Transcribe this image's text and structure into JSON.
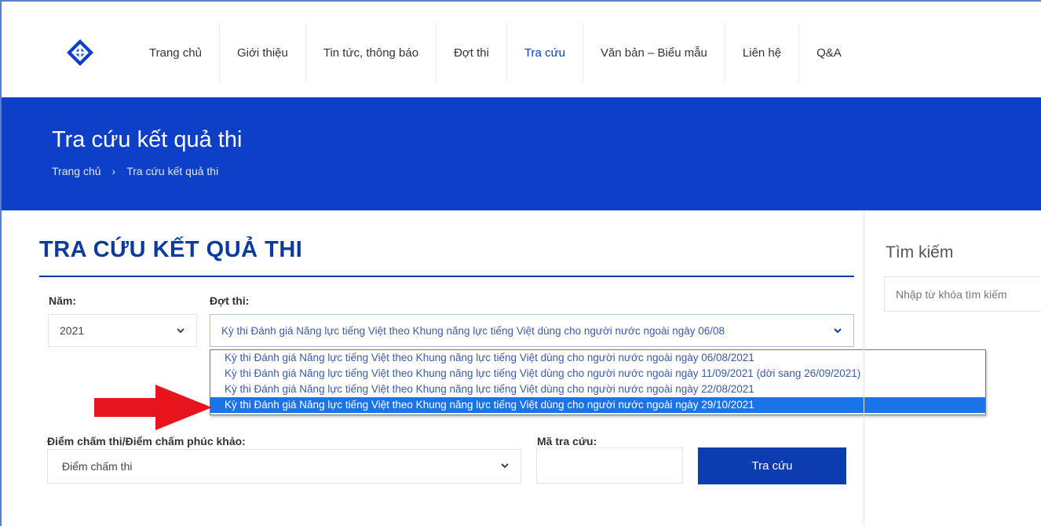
{
  "nav": {
    "items": [
      {
        "label": "Trang chủ",
        "active": false
      },
      {
        "label": "Giới thiệu",
        "active": false
      },
      {
        "label": "Tin tức, thông báo",
        "active": false
      },
      {
        "label": "Đợt thi",
        "active": false
      },
      {
        "label": "Tra cứu",
        "active": true
      },
      {
        "label": "Văn bản – Biểu mẫu",
        "active": false
      },
      {
        "label": "Liên hệ",
        "active": false
      },
      {
        "label": "Q&A",
        "active": false
      }
    ]
  },
  "banner": {
    "title": "Tra cứu kết quả thi",
    "breadcrumb": [
      "Trang chủ",
      "›",
      "Tra cứu kết quả thi"
    ]
  },
  "main": {
    "title": "TRA CỨU KẾT QUẢ THI",
    "year_label": "Năm:",
    "year_value": "2021",
    "exam_label": "Đợt thi:",
    "exam_value": "Kỳ thi Đánh giá Năng lực tiếng Việt theo Khung năng lực tiếng Việt dùng cho người nước ngoài ngày 06/08",
    "exam_options": [
      "Kỳ thi Đánh giá Năng lực tiếng Việt theo Khung năng lực tiếng Việt dùng cho người nước ngoài ngày 06/08/2021",
      "Kỳ thi Đánh giá Năng lực tiếng Việt theo Khung năng lực tiếng Việt dùng cho người nước ngoài ngày 11/09/2021 (dời sang 26/09/2021)",
      "Kỳ thi Đánh giá Năng lực tiếng Việt theo Khung năng lực tiếng Việt dùng cho người nước ngoài ngày 22/08/2021",
      "Kỳ thi Đánh giá Năng lực tiếng Việt theo Khung năng lực tiếng Việt dùng cho người nước ngoài ngày 29/10/2021"
    ],
    "exam_selected_index": 3,
    "score_label": "Điểm chấm thi/Điểm chấm phúc khảo:",
    "score_value": "Điểm chấm thi",
    "code_label": "Mã tra cứu:",
    "code_value": "",
    "submit_label": "Tra cứu"
  },
  "sidebar": {
    "title": "Tìm kiếm",
    "search_placeholder": "Nhập từ khóa tìm kiếm"
  },
  "colors": {
    "brand_blue": "#0d40c7",
    "title_blue": "#0d3a9e",
    "selected_option": "#1a73e8",
    "annotation_arrow": "#e8141c"
  },
  "icons": {
    "logo": "logo-icon",
    "dropdown": "chevron-down-icon",
    "annotation": "red-arrow-icon"
  }
}
